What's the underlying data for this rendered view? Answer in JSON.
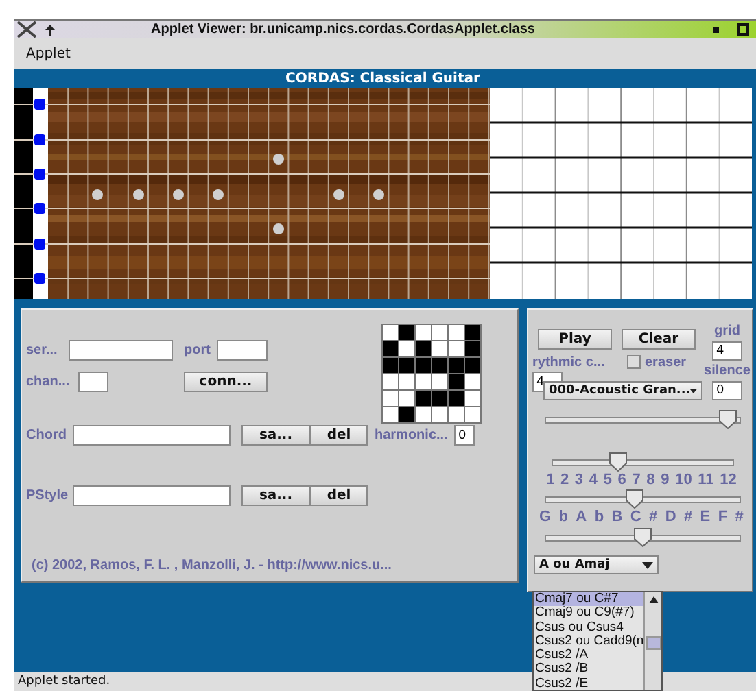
{
  "window": {
    "title": "Applet Viewer: br.unicamp.nics.cordas.CordasApplet.class"
  },
  "menu": [
    "Applet"
  ],
  "applet": {
    "title": "CORDAS: Classical Guitar"
  },
  "connection": {
    "server_label": "ser...",
    "port_label": "port",
    "channel_label": "chan...",
    "button": "conn..."
  },
  "pattern": [
    [
      false,
      true,
      false,
      false,
      false,
      true
    ],
    [
      true,
      false,
      true,
      false,
      false,
      true
    ],
    [
      true,
      true,
      true,
      true,
      true,
      true
    ],
    [
      false,
      false,
      false,
      false,
      true,
      false
    ],
    [
      false,
      false,
      true,
      true,
      true,
      false
    ],
    [
      false,
      true,
      false,
      false,
      false,
      false
    ]
  ],
  "chord": {
    "label": "Chord",
    "buttons": [
      "sa...",
      "del"
    ],
    "harmonic_label": "harmonic...",
    "harmonic_value": "0"
  },
  "pstyle": {
    "label": "PStyle",
    "buttons": [
      "sa...",
      "del"
    ]
  },
  "credits": "(c) 2002, Ramos, F. L. , Manzolli, J. - http://www.nics.u...",
  "controls": {
    "play": "Play",
    "clear": "Clear",
    "grid_label": "grid",
    "grid_value": "4",
    "rhythmic_label": "rythmic c...",
    "rhythmic_value": "4",
    "eraser": {
      "label": "eraser",
      "checked": false
    },
    "silence_label": "silence",
    "silence_value": "0",
    "instrument": "000-Acoustic Gran...",
    "sliders": [
      {
        "level": 0.98
      },
      {
        "level": 0.35,
        "labels": [
          "1",
          "2",
          "3",
          "4",
          "5",
          "6",
          "7",
          "8",
          "9",
          "10",
          "11",
          "12"
        ]
      },
      {
        "level": 0.45,
        "labels": [
          "G",
          "b",
          "A",
          "b",
          "B",
          "C",
          "#",
          "D",
          "#",
          "E",
          "F",
          "#"
        ]
      },
      {
        "level": 0.5
      }
    ]
  },
  "chord_select": {
    "value": "A ou Amaj",
    "options": [
      {
        "label": "Cmaj7 ou C#7",
        "selected": true
      },
      {
        "label": "Cmaj9 ou C9(#7)",
        "selected": false
      },
      {
        "label": "Csus ou Csus4",
        "selected": false
      },
      {
        "label": "Csus2 ou Cadd9(n",
        "selected": false
      },
      {
        "label": "Csus2 /A",
        "selected": false
      },
      {
        "label": "Csus2 /B",
        "selected": false
      },
      {
        "label": "Csus2 /E",
        "selected": false
      }
    ]
  },
  "status_bar": "Applet started."
}
